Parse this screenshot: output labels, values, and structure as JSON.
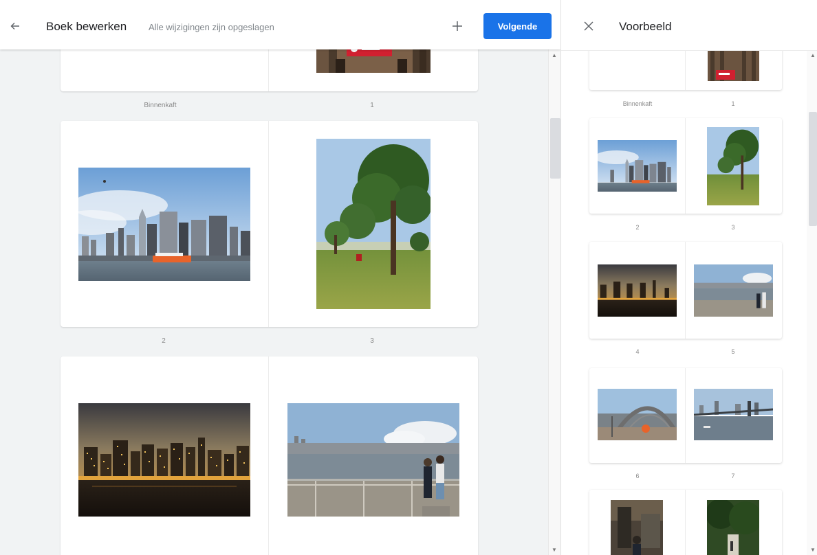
{
  "editor": {
    "title": "Boek bewerken",
    "save_status": "Alle wijzigingen zijn opgeslagen",
    "next_label": "Volgende",
    "page_labels": {
      "inside_cover": "Binnenkaft",
      "p1": "1",
      "p2": "2",
      "p3": "3"
    },
    "photos": {
      "p1": "red-sign-storefront-photo",
      "p2": "manhattan-skyline-photo",
      "p3": "park-tree-photo",
      "p4": "city-night-skyline-photo",
      "p5": "waterfront-couple-photo"
    }
  },
  "preview": {
    "title": "Voorbeeld",
    "labels": {
      "inside_cover": "Binnenkaft",
      "p1": "1",
      "p2": "2",
      "p3": "3",
      "p4": "4",
      "p5": "5",
      "p6": "6",
      "p7": "7"
    },
    "photos": {
      "p6": "bridge-arch-photo",
      "p7": "brooklyn-bridge-photo",
      "p8": "street-scene-photo",
      "p9": "tree-path-photo"
    }
  },
  "colors": {
    "accent": "#1a73e8",
    "background": "#f1f3f4",
    "page": "#ffffff"
  },
  "icons": {
    "back": "arrow-left-icon",
    "add": "plus-icon",
    "close": "close-icon"
  }
}
